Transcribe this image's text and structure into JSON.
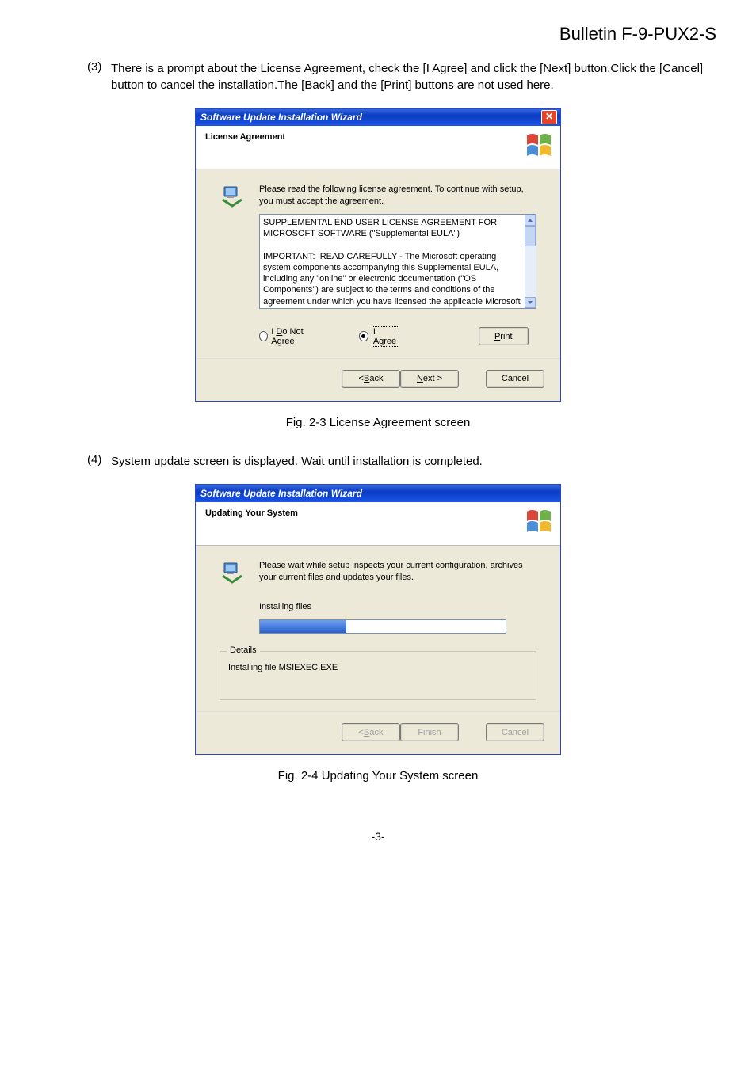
{
  "bulletin": "Bulletin F-9-PUX2-S",
  "step3": {
    "num": "(3)",
    "text": "There is a prompt about the License Agreement, check the [I Agree] and click the [Next] button.Click the [Cancel] button to cancel the installation.The [Back] and the [Print] buttons are not used here."
  },
  "step4": {
    "num": "(4)",
    "text": "System update screen is displayed.  Wait until installation is completed."
  },
  "dialog1": {
    "title": "Software Update Installation Wizard",
    "header": "License Agreement",
    "intro": "Please read the following license agreement. To continue with setup, you must accept the agreement.",
    "license_text": "SUPPLEMENTAL END USER LICENSE AGREEMENT FOR MICROSOFT SOFTWARE (\"Supplemental EULA\")\n\nIMPORTANT:  READ CAREFULLY - The Microsoft operating system components accompanying this Supplemental EULA, including any \"online\" or electronic documentation (\"OS Components\") are subject to the terms and conditions of the agreement under which you have licensed the applicable Microsoft operating system product described below (each an",
    "radio_not_agree_prefix": "I ",
    "radio_not_agree_u": "D",
    "radio_not_agree_suffix": "o Not Agree",
    "radio_agree_prefix": "I ",
    "radio_agree_u": "A",
    "radio_agree_suffix": "gree",
    "print_u": "P",
    "print_suffix": "rint",
    "back_prefix": "< ",
    "back_u": "B",
    "back_suffix": "ack",
    "next_u": "N",
    "next_suffix": "ext >",
    "cancel": "Cancel"
  },
  "caption1": "Fig. 2-3 License Agreement screen",
  "dialog2": {
    "title": "Software Update Installation Wizard",
    "header": "Updating Your System",
    "intro": "Please wait while setup inspects your current configuration, archives your current files and updates your files.",
    "status": "Installing files",
    "details_label": "Details",
    "details_text": "Installing file MSIEXEC.EXE",
    "back_prefix": "< ",
    "back_u": "B",
    "back_suffix": "ack",
    "finish": "Finish",
    "cancel": "Cancel"
  },
  "caption2": "Fig. 2-4 Updating Your System screen",
  "pagenum": "-3-"
}
